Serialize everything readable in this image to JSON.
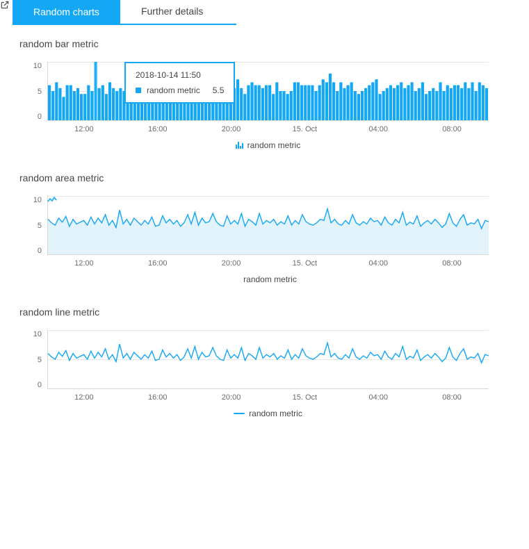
{
  "tabs": {
    "active": "Random charts",
    "inactive": "Further details"
  },
  "y_ticks": [
    "10",
    "5",
    "0"
  ],
  "x_ticks": [
    "12:00",
    "16:00",
    "20:00",
    "15. Oct",
    "04:00",
    "08:00"
  ],
  "tooltip": {
    "date": "2018-10-14 11:50",
    "series": "random metric",
    "value": "5.5"
  },
  "charts": [
    {
      "title": "random bar metric",
      "legend": "random metric",
      "type": "bar"
    },
    {
      "title": "random area metric",
      "legend": "random metric",
      "type": "area"
    },
    {
      "title": "random line metric",
      "legend": "random metric",
      "type": "line"
    }
  ],
  "chart_data": [
    {
      "type": "bar",
      "title": "random bar metric",
      "series_name": "random metric",
      "x_ticks": [
        "12:00",
        "16:00",
        "20:00",
        "15. Oct",
        "04:00",
        "08:00"
      ],
      "ylim": [
        0,
        10
      ],
      "tooltip": {
        "time": "2018-10-14 11:50",
        "value": 5.5
      },
      "values": [
        6.0,
        5.0,
        6.5,
        5.5,
        4.0,
        6.0,
        6.0,
        5.0,
        5.5,
        4.5,
        4.5,
        6.0,
        5.0,
        10.0,
        5.5,
        6.0,
        4.5,
        6.5,
        5.5,
        5.0,
        5.5,
        5.0,
        6.0,
        5.0,
        6.5,
        6.0,
        4.5,
        5.5,
        5.0,
        5.5,
        6.0,
        6.5,
        6.5,
        6.0,
        5.0,
        6.0,
        5.5,
        5.5,
        6.0,
        4.0,
        5.5,
        6.5,
        6.5,
        4.0,
        5.0,
        6.0,
        5.0,
        7.0,
        6.0,
        5.5,
        5.5,
        5.0,
        5.5,
        7.0,
        5.5,
        4.5,
        6.0,
        6.5,
        6.0,
        6.0,
        5.5,
        6.0,
        6.0,
        4.5,
        6.5,
        5.0,
        5.0,
        4.5,
        5.0,
        6.5,
        6.5,
        6.0,
        6.0,
        6.0,
        6.0,
        5.0,
        6.0,
        7.0,
        6.5,
        8.0,
        6.5,
        5.0,
        6.5,
        5.5,
        6.0,
        6.5,
        5.0,
        4.5,
        5.0,
        5.5,
        6.0,
        6.5,
        7.0,
        4.5,
        5.0,
        5.5,
        6.0,
        5.5,
        6.0,
        6.5,
        5.5,
        6.0,
        6.5,
        5.0,
        5.5,
        6.5,
        4.5,
        5.0,
        5.5,
        5.0,
        6.5,
        5.0,
        6.0,
        5.5,
        6.0,
        6.0,
        5.5,
        6.5,
        5.5,
        6.5,
        5.0,
        6.5,
        6.0,
        5.5
      ]
    },
    {
      "type": "area",
      "title": "random area metric",
      "series_name": "random metric",
      "x_ticks": [
        "12:00",
        "16:00",
        "20:00",
        "15. Oct",
        "04:00",
        "08:00"
      ],
      "ylim": [
        0,
        10
      ],
      "values": [
        6.0,
        5.4,
        5.0,
        6.2,
        5.5,
        6.5,
        4.8,
        6.0,
        5.2,
        5.5,
        5.8,
        5.0,
        6.4,
        5.2,
        6.2,
        5.4,
        6.8,
        5.0,
        5.8,
        4.6,
        7.6,
        5.2,
        6.0,
        5.0,
        6.2,
        5.6,
        5.0,
        5.8,
        5.2,
        6.4,
        4.8,
        5.0,
        6.6,
        5.4,
        6.0,
        5.2,
        5.8,
        4.8,
        5.4,
        6.8,
        5.2,
        7.2,
        5.0,
        6.2,
        5.4,
        5.6,
        7.0,
        5.6,
        5.0,
        4.8,
        6.6,
        5.2,
        5.8,
        5.2,
        7.0,
        4.8,
        6.0,
        5.6,
        5.0,
        7.0,
        5.2,
        5.8,
        5.4,
        6.0,
        5.0,
        5.6,
        5.2,
        6.6,
        5.0,
        5.8,
        5.2,
        6.8,
        5.6,
        5.2,
        5.0,
        5.4,
        6.0,
        5.8,
        7.8,
        5.4,
        6.0,
        5.2,
        5.0,
        5.8,
        5.2,
        6.8,
        5.4,
        5.0,
        5.6,
        5.2,
        6.2,
        5.6,
        5.8,
        5.0,
        6.4,
        5.4,
        5.0,
        6.0,
        5.4,
        7.2,
        5.0,
        5.5,
        5.2,
        6.6,
        4.8,
        5.4,
        5.8,
        5.2,
        6.0,
        5.4,
        4.6,
        5.2,
        7.0,
        5.4,
        4.8,
        6.0,
        6.8,
        5.0,
        5.4,
        5.2,
        6.0,
        4.4,
        5.8,
        5.6
      ]
    },
    {
      "type": "line",
      "title": "random line metric",
      "series_name": "random metric",
      "x_ticks": [
        "12:00",
        "16:00",
        "20:00",
        "15. Oct",
        "04:00",
        "08:00"
      ],
      "ylim": [
        0,
        10
      ],
      "values": [
        6.0,
        5.4,
        5.0,
        6.2,
        5.5,
        6.5,
        4.8,
        6.0,
        5.2,
        5.5,
        5.8,
        5.0,
        6.4,
        5.2,
        6.2,
        5.4,
        6.8,
        5.0,
        5.8,
        4.6,
        7.6,
        5.2,
        6.0,
        5.0,
        6.2,
        5.6,
        5.0,
        5.8,
        5.2,
        6.4,
        4.8,
        5.0,
        6.6,
        5.4,
        6.0,
        5.2,
        5.8,
        4.8,
        5.4,
        6.8,
        5.2,
        7.2,
        5.0,
        6.2,
        5.4,
        5.6,
        7.0,
        5.6,
        5.0,
        4.8,
        6.6,
        5.2,
        5.8,
        5.2,
        7.0,
        4.8,
        6.0,
        5.6,
        5.0,
        7.0,
        5.2,
        5.8,
        5.4,
        6.0,
        5.0,
        5.6,
        5.2,
        6.6,
        5.0,
        5.8,
        5.2,
        6.8,
        5.6,
        5.2,
        5.0,
        5.4,
        6.0,
        5.8,
        7.8,
        5.4,
        6.0,
        5.2,
        5.0,
        5.8,
        5.2,
        6.8,
        5.4,
        5.0,
        5.6,
        5.2,
        6.2,
        5.6,
        5.8,
        5.0,
        6.4,
        5.4,
        5.0,
        6.0,
        5.4,
        7.2,
        5.0,
        5.5,
        5.2,
        6.6,
        4.8,
        5.4,
        5.8,
        5.2,
        6.0,
        5.4,
        4.6,
        5.2,
        7.0,
        5.4,
        4.8,
        6.0,
        6.8,
        5.0,
        5.4,
        5.2,
        6.0,
        4.4,
        5.8,
        5.6
      ]
    }
  ]
}
